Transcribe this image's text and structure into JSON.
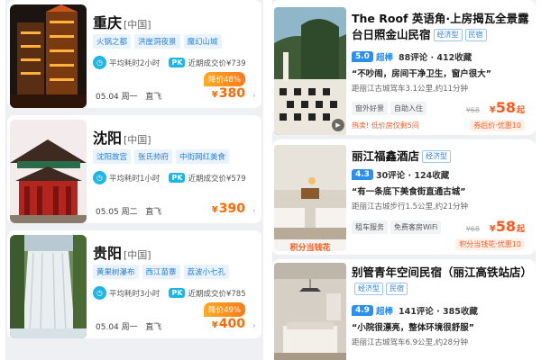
{
  "destinations": [
    {
      "city": "重庆",
      "country": "[中国]",
      "tags": [
        "火锅之都",
        "洪崖洞夜景",
        "魔幻山城"
      ],
      "duration": "平均耗时2小时",
      "pk_label": "PK",
      "recent_price": "近期成交价¥739",
      "date": "05.04 周一",
      "flight": "直飞",
      "discount": "降价48%",
      "currency": "¥",
      "price": "380"
    },
    {
      "city": "沈阳",
      "country": "[中国]",
      "tags": [
        "沈阳故宫",
        "张氏帅府",
        "中街网红美食"
      ],
      "duration": "平均耗时1小时",
      "pk_label": "PK",
      "recent_price": "近期成交价¥579",
      "date": "05.05 周二",
      "flight": "直飞",
      "discount": "",
      "currency": "¥",
      "price": "390"
    },
    {
      "city": "贵阳",
      "country": "[中国]",
      "tags": [
        "黄果树瀑布",
        "西江苗寨",
        "荔波小七孔"
      ],
      "duration": "平均耗时3小时",
      "pk_label": "PK",
      "recent_price": "近期成交价¥785",
      "date": "05.04 周一",
      "flight": "直飞",
      "discount": "降价49%",
      "currency": "¥",
      "price": "400"
    }
  ],
  "hotels": [
    {
      "title": "The Roof 英语角·上房揭瓦全景露台日照金山民宿",
      "badges": [
        "经济型",
        "民宿"
      ],
      "score": "5.0",
      "score_word": "超棒",
      "reviews": "88评论 · 412收藏",
      "quote": "“不吵闹，房间干净卫生，窗户很大”",
      "distance": "距丽江古城驾车3.1公里,约11分钟",
      "features": [
        "窗外好景",
        "自助入住"
      ],
      "hot_text": "热卖! 低价房仅剩5间",
      "original_price": "¥68",
      "currency": "¥",
      "price": "58",
      "price_suffix": "起",
      "coupon": "券后价·优惠10",
      "image_caption": ""
    },
    {
      "title": "丽江福鑫酒店",
      "badges": [
        "经济型"
      ],
      "score": "4.3",
      "score_word": "",
      "reviews": "30评论 · 124收藏",
      "quote": "“有一条底下美食街直通古城”",
      "distance": "距丽江古城步行1.5公里,约21分钟",
      "features": [
        "租车服务",
        "免费客房WiFi"
      ],
      "hot_text": "",
      "original_price": "¥68",
      "currency": "¥",
      "price": "58",
      "price_suffix": "起",
      "coupon": "积分当钱花·优惠10",
      "image_caption": "积分当钱花"
    },
    {
      "title": "别管青年空间民宿（丽江高铁站店）",
      "badges": [
        "经济型",
        "民宿"
      ],
      "score": "4.9",
      "score_word": "超棒",
      "reviews": "141评论 · 385收藏",
      "quote": "“小院很漂亮，整体环境很舒服”",
      "distance": "距丽江古城驾车6.9公里,约28分钟",
      "features": [],
      "hot_text": "",
      "original_price": "",
      "currency": "",
      "price": "",
      "price_suffix": "",
      "coupon": "",
      "image_caption": ""
    }
  ],
  "icons": {
    "duration": "clock-icon",
    "arrow": "chevron-right-icon",
    "video": "play-icon"
  },
  "colors": {
    "accent_blue": "#2a8ff0",
    "price_orange": "#ff6a00",
    "tag_bg": "#e8f3fd"
  }
}
